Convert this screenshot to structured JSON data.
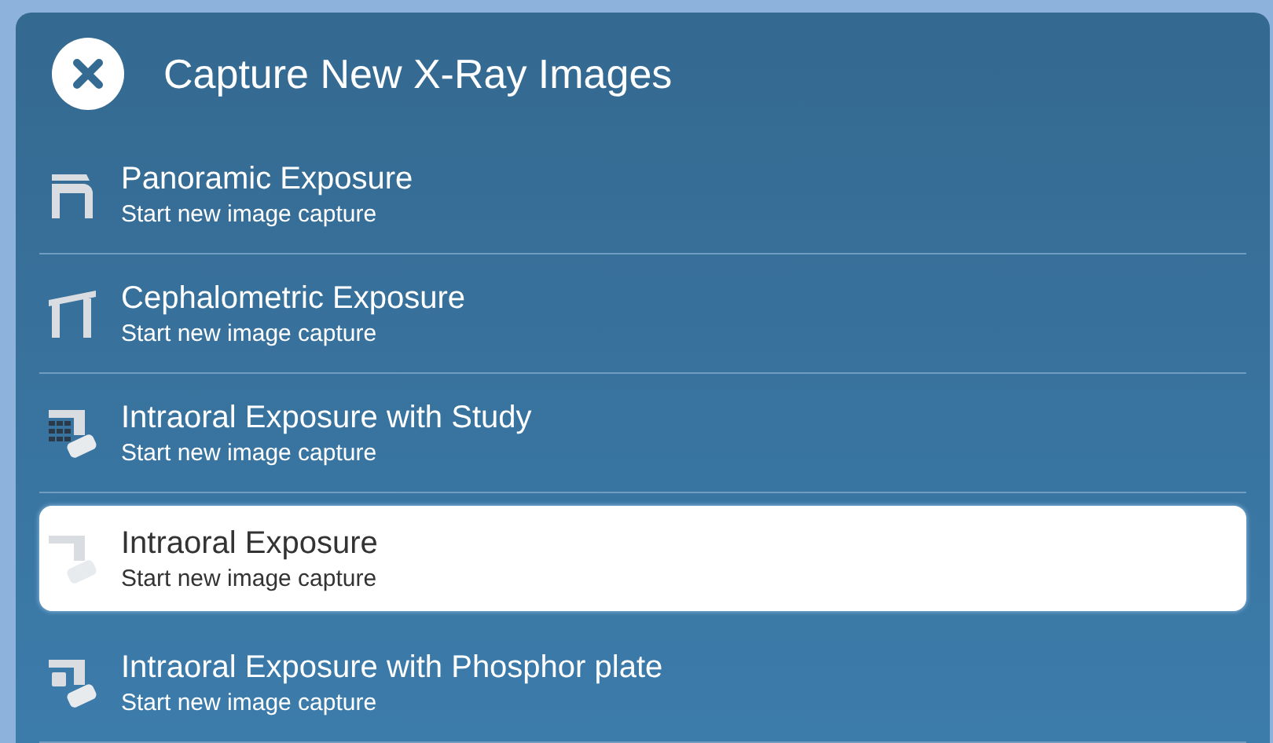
{
  "dialog": {
    "title": "Capture New X-Ray Images"
  },
  "items": [
    {
      "kind": "panoramic",
      "title": "Panoramic Exposure",
      "subtitle": "Start new image capture",
      "selected": false
    },
    {
      "kind": "cephalometric",
      "title": "Cephalometric Exposure",
      "subtitle": "Start new image capture",
      "selected": false
    },
    {
      "kind": "intraoral_study",
      "title": "Intraoral Exposure with Study",
      "subtitle": "Start new image capture",
      "selected": false
    },
    {
      "kind": "intraoral",
      "title": "Intraoral Exposure",
      "subtitle": "Start new image capture",
      "selected": true
    },
    {
      "kind": "intraoral_phosphor",
      "title": "Intraoral Exposure with Phosphor plate",
      "subtitle": "Start new image capture",
      "selected": false
    }
  ]
}
